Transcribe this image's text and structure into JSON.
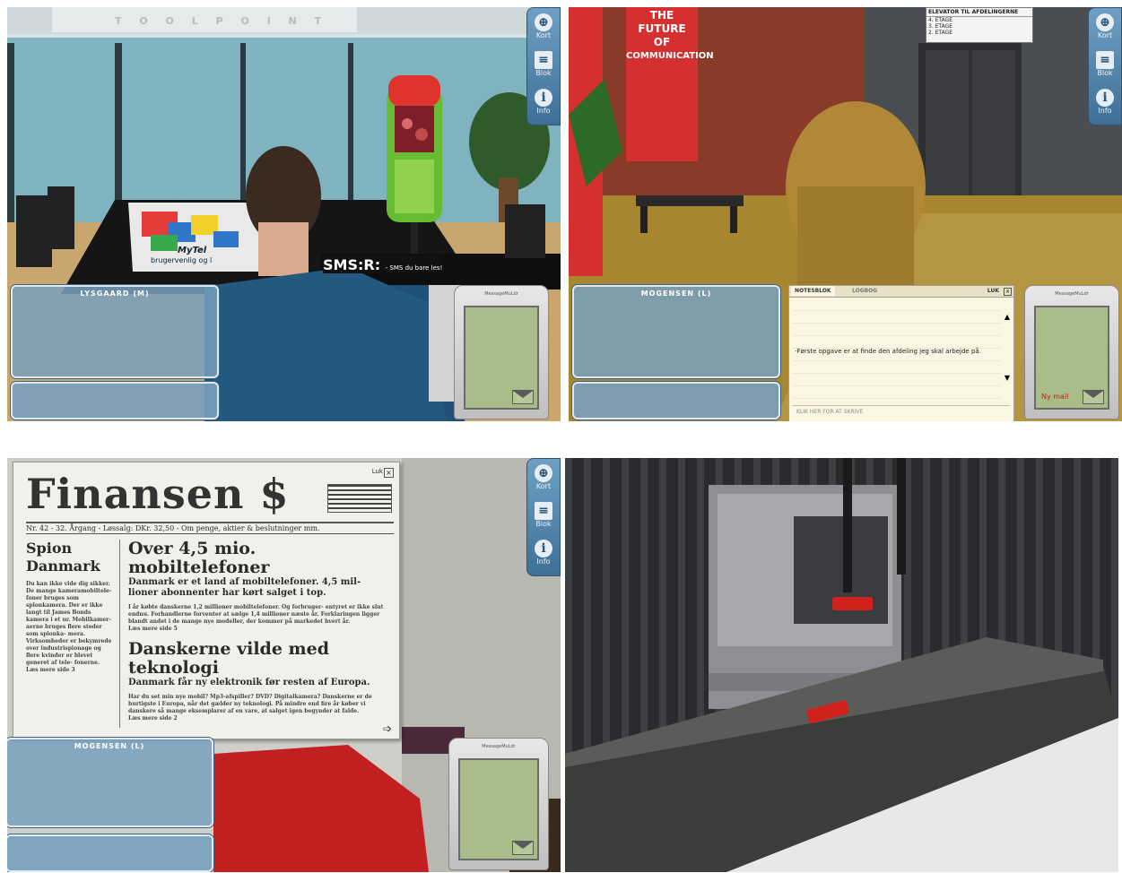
{
  "panel1": {
    "sign_top": "T O O L P O I N T",
    "poster_text": "MyTel",
    "poster_line2": "brugervenlig og l",
    "sms_sign": "SMS:R:",
    "sms_sign_small": "- SMS du bare les!",
    "chat_title": "LYSGAARD (M)"
  },
  "panel2": {
    "banner_lines": [
      "THE",
      "FUTURE",
      "OF",
      "COMMUNICATION"
    ],
    "elevator_title": "ELEVATOR TIL AFDELINGERNE",
    "elevator_rows": [
      "4. ETAGE",
      "3. ETAGE",
      "2. ETAGE"
    ],
    "chat_title": "MOGENSEN (L)",
    "notepad": {
      "tab_active": "NOTESBLOK",
      "tab_inactive": "LOGBOG",
      "close_label": "LUK",
      "text": "-Første opgave er at finde den afdeling jeg skal arbejde på.",
      "input_placeholder": "KLIK HER FOR AT SKRIVE"
    },
    "phone_newmail": "Ny mail"
  },
  "panel3": {
    "paper": {
      "title": "Finansen $",
      "close_label": "Luk",
      "subtitle": "Nr. 42 - 32. Årgang - Løssalg: DKr. 32,50 - Om penge, aktier & beslutninger mm.",
      "left_heading": "Spion Danmark",
      "left_body": "Du kan ikke vide dig sikker. De mange kameramobiltele- foner bruges som spionkamera. Der er ikke langt til James Bonds kamera i et ur. Mobilkamer- aerne bruges flere steder som spionka- mera. Virksomheder er bekymrede over industrispionage og flere kvinder er blevet generet af tele- fonerne.",
      "left_more": "Læs mere side 3",
      "article1_heading": "Over 4,5 mio. mobiltelefoner",
      "article1_sub": "Danmark er et land af mobiltelefoner. 4,5 mil- lioner abonnenter har kørt salget i top.",
      "article1_body": "I år købte danskerne 1,2 millioner mobiltelefoner. Og forbruger- entyret er ikke slut endnu. Forhandlerne forventer at sælge 1,4 millioner næste år. Forklaringen ligger blandt andet i de mange nye modeller, der kommer på markedet hvert år.",
      "article1_more": "Læs mere side 5",
      "article2_heading": "Danskerne vilde med teknologi",
      "article2_sub": "Danmark får ny elektronik før resten af Europa.",
      "article2_body": "Har du set min nye mobil? Mp3-afspiller? DVD? Digitalkamera? Danskerne er de hurtigste i Europa, når det gælder ny teknologi. På mindre end fire år køber vi danskere så mange eksemplarer af en vare, at salget igen begynder at falde.",
      "article2_more": "Læs mere side 2"
    },
    "chat_title": "MOGENSEN (L)"
  },
  "sidemenu": {
    "items": [
      {
        "label": "Kort",
        "icon": "globe-icon"
      },
      {
        "label": "Blok",
        "icon": "notepad-icon"
      },
      {
        "label": "Info",
        "icon": "info-icon"
      }
    ]
  },
  "phone": {
    "brand": "MessageMuLdr"
  },
  "colors": {
    "chat_blue": "#789fbe",
    "phone_screen": "#a9bd8a",
    "banner_red": "#d53030"
  }
}
